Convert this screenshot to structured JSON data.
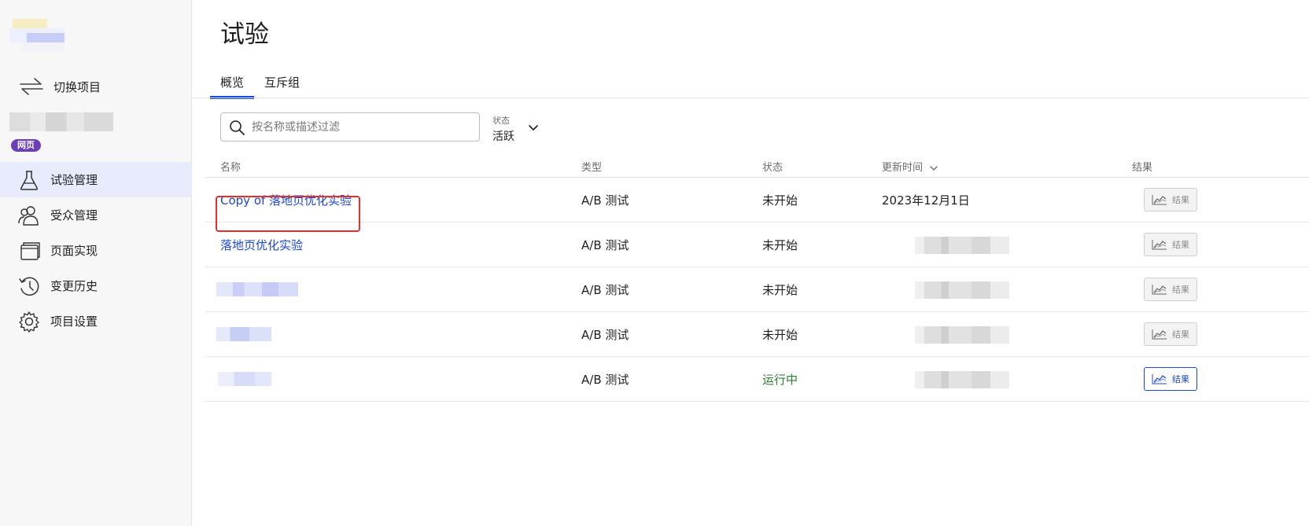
{
  "sidebar": {
    "switch_label": "切换项目",
    "platform_badge": "网页",
    "items": [
      {
        "label": "试验管理",
        "icon": "flask-icon",
        "active": true
      },
      {
        "label": "受众管理",
        "icon": "users-icon",
        "active": false
      },
      {
        "label": "页面实现",
        "icon": "pages-icon",
        "active": false
      },
      {
        "label": "变更历史",
        "icon": "history-icon",
        "active": false
      },
      {
        "label": "项目设置",
        "icon": "gear-icon",
        "active": false
      }
    ]
  },
  "main": {
    "title": "试验",
    "tabs": [
      {
        "label": "概览",
        "active": true
      },
      {
        "label": "互斥组",
        "active": false
      }
    ],
    "search_placeholder": "按名称或描述过滤",
    "status_filter": {
      "label": "状态",
      "value": "活跃"
    },
    "table": {
      "headers": {
        "name": "名称",
        "type": "类型",
        "status": "状态",
        "updated": "更新时间",
        "results": "结果"
      },
      "rows": [
        {
          "name": "Copy of 落地页优化实验",
          "type": "A/B 测试",
          "status": "未开始",
          "updated": "2023年12月1日",
          "result_label": "结果"
        },
        {
          "name": "落地页优化实验",
          "type": "A/B 测试",
          "status": "未开始",
          "updated": "",
          "result_label": "结果"
        },
        {
          "name": "",
          "type": "A/B 测试",
          "status": "未开始",
          "updated": "",
          "result_label": "结果"
        },
        {
          "name": "",
          "type": "A/B 测试",
          "status": "未开始",
          "updated": "",
          "result_label": "结果"
        },
        {
          "name": "",
          "type": "A/B 测试",
          "status": "运行中",
          "updated": "",
          "result_label": "结果"
        }
      ]
    }
  },
  "colors": {
    "accent": "#1b47d6",
    "running": "#2e7d32",
    "highlight": "#e03131",
    "badge": "#6a3fb8",
    "active_nav": "#e7ebfb"
  }
}
